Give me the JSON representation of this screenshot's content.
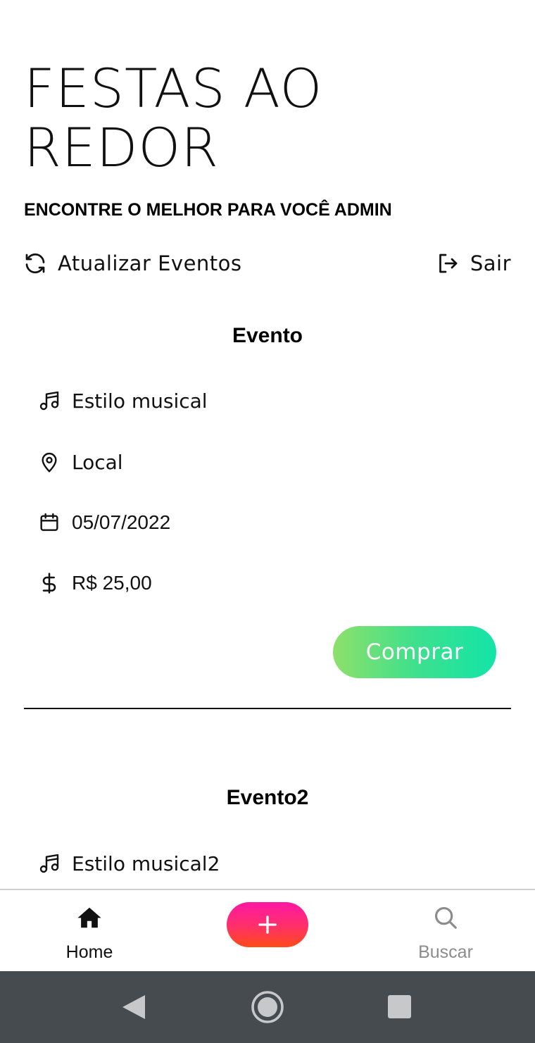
{
  "header": {
    "title": "FESTAS AO REDOR",
    "subtitle": "ENCONTRE O MELHOR PARA VOCÊ ADMIN",
    "refresh_label": "Atualizar Eventos",
    "logout_label": "Sair",
    "refresh_icon": "refresh-icon",
    "logout_icon": "logout-icon"
  },
  "events": [
    {
      "name": "Evento",
      "style": "Estilo musical",
      "location": "Local",
      "date": "05/07/2022",
      "price": "R$ 25,00",
      "buy_label": "Comprar"
    },
    {
      "name": "Evento2",
      "style": "Estilo musical2"
    }
  ],
  "tabbar": {
    "home_label": "Home",
    "search_label": "Buscar",
    "add_icon": "plus-icon",
    "home_icon": "home-icon",
    "search_icon": "search-icon"
  },
  "colors": {
    "buy_gradient": [
      "#8ee06a",
      "#13e4a8"
    ],
    "fab_gradient": [
      "#ff17a4",
      "#ff4a18"
    ],
    "active_tab": "#111111",
    "inactive_tab": "#8c8c8c",
    "system_nav": "#464b50"
  }
}
